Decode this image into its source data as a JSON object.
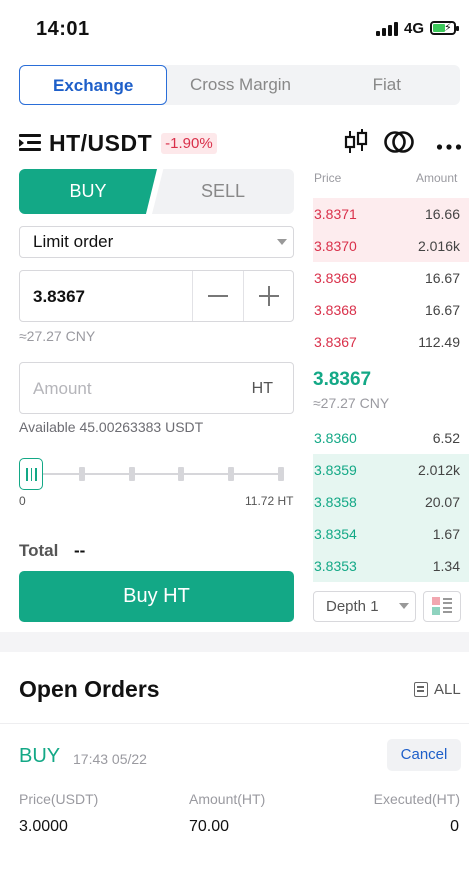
{
  "status_bar": {
    "time": "14:01",
    "network": "4G"
  },
  "tabs": [
    {
      "label": "Exchange",
      "active": true
    },
    {
      "label": "Cross Margin",
      "active": false
    },
    {
      "label": "Fiat",
      "active": false
    }
  ],
  "pair": {
    "name": "HT/USDT",
    "change": "-1.90%"
  },
  "form": {
    "buy_label": "BUY",
    "sell_label": "SELL",
    "order_type": "Limit order",
    "price": "3.8367",
    "price_cny": "≈27.27 CNY",
    "amount_placeholder": "Amount",
    "amount_unit": "HT",
    "available": "Available 45.00263383 USDT",
    "slider_min": "0",
    "slider_max": "11.72 HT",
    "slider_level": 0,
    "total_label": "Total",
    "total_value": "--",
    "submit_label": "Buy  HT"
  },
  "order_book": {
    "price_header": "Price",
    "amount_header": "Amount",
    "asks": [
      {
        "price": "3.8371",
        "amount": "16.66",
        "depth": 1.0
      },
      {
        "price": "3.8370",
        "amount": "2.016k",
        "depth": 1.0
      },
      {
        "price": "3.8369",
        "amount": "16.67",
        "depth": 0
      },
      {
        "price": "3.8368",
        "amount": "16.67",
        "depth": 0
      },
      {
        "price": "3.8367",
        "amount": "112.49",
        "depth": 0
      }
    ],
    "mid_price": "3.8367",
    "mid_cny": "≈27.27 CNY",
    "bids": [
      {
        "price": "3.8360",
        "amount": "6.52",
        "depth": 0
      },
      {
        "price": "3.8359",
        "amount": "2.012k",
        "depth": 1.0
      },
      {
        "price": "3.8358",
        "amount": "20.07",
        "depth": 1.0
      },
      {
        "price": "3.8354",
        "amount": "1.67",
        "depth": 1.0
      },
      {
        "price": "3.8353",
        "amount": "1.34",
        "depth": 1.0
      }
    ],
    "depth_label": "Depth 1"
  },
  "open_orders": {
    "title": "Open Orders",
    "all_label": "ALL",
    "orders": [
      {
        "side": "BUY",
        "time": "17:43 05/22",
        "cancel_label": "Cancel",
        "price_header": "Price(USDT)",
        "amount_header": "Amount(HT)",
        "executed_header": "Executed(HT)",
        "price": "3.0000",
        "amount": "70.00",
        "executed": "0"
      }
    ]
  },
  "colors": {
    "buy": "#13a886",
    "sell": "#d9304a",
    "accent": "#1e5fc9"
  }
}
